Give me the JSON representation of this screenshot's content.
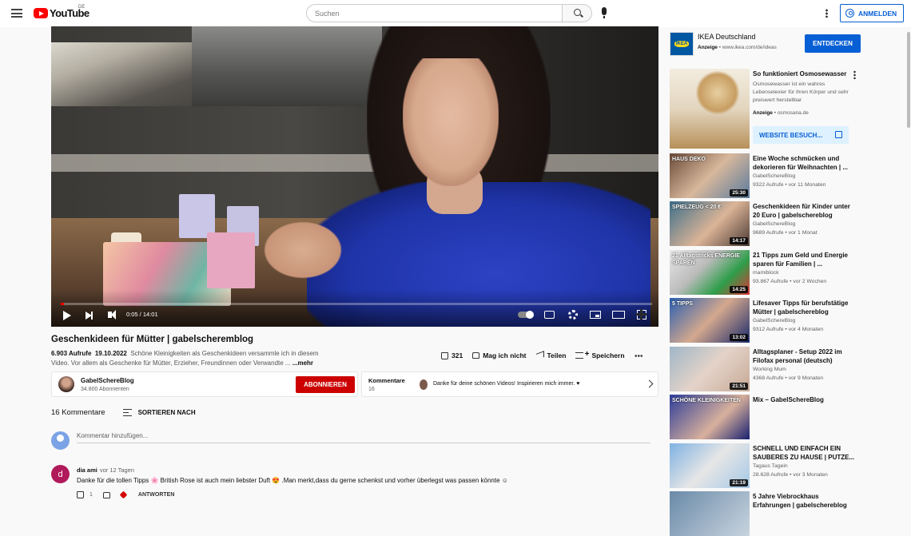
{
  "header": {
    "logo_text": "YouTube",
    "logo_country": "DE",
    "search_placeholder": "Suchen",
    "signin_label": "ANMELDEN"
  },
  "player": {
    "time": "0:05 / 14:01",
    "progress_fraction": 0.006
  },
  "video": {
    "title": "Geschenkideen für Mütter | gabelscheremblog",
    "views": "6.903 Aufrufe",
    "date": "19.10.2022",
    "description_line1": "Schöne Kleinigkeiten als Geschenkideen versammle ich in diesem",
    "description_line2": "Video. Vor allem als Geschenke für Mütter, Erzieher, Freundinnen oder Verwandte ...",
    "more_label": "...mehr",
    "likes": "321",
    "dislike_label": "Mag ich nicht",
    "share_label": "Teilen",
    "save_label": "Speichern"
  },
  "channel": {
    "name": "GabelSchereBlog",
    "subscribers": "34.800 Abonnenten",
    "subscribe_label": "ABONNIEREN"
  },
  "comments_teaser": {
    "label": "Kommentare",
    "count": "16",
    "text": "Danke für deine schönen Videos! Inspirieren mich immer. ♥"
  },
  "comments": {
    "count_label": "16 Kommentare",
    "sort_label": "SORTIEREN NACH",
    "add_placeholder": "Kommentar hinzufügen...",
    "items": [
      {
        "avatar_letter": "d",
        "author": "dia ami",
        "time": "vor 12 Tagen",
        "text": "Danke für die tollen Tipps 🌸 British Rose ist auch mein liebster Duft 😍 .Man merkt,dass du gerne schenkst und vorher überlegst was passen könnte ☺",
        "likes": "1",
        "reply_label": "ANTWORTEN"
      }
    ]
  },
  "ad": {
    "advertiser": "IKEA Deutschland",
    "logo_text": "IKEA",
    "ad_label": "Anzeige",
    "url": "www.ikea.com/de/ideas",
    "cta": "ENTDECKEN"
  },
  "promo": {
    "title": "So funktioniert Osmosewasser",
    "description": "Osmosewasser ist ein wahres Lebenselexier für ihren Körper und sehr preiswert herstellbar",
    "ad_label": "Anzeige",
    "domain": "osmosana.de",
    "cta": "WEBSITE BESUCH..."
  },
  "recommendations": [
    {
      "title": "Eine Woche schmücken und dekorieren für Weihnachten | ...",
      "channel": "GabelSchereBlog",
      "views": "9322 Aufrufe • vor 11 Monaten",
      "duration": "25:30",
      "thumb_text": "HAUS DEKO"
    },
    {
      "title": "Geschenkideen für Kinder unter 20 Euro | gabelschereblog",
      "channel": "GabelSchereBlog",
      "views": "9689 Aufrufe • vor 1 Monat",
      "duration": "14:17",
      "thumb_text": "SPIELZEUG < 20 €"
    },
    {
      "title": "21 Tipps zum Geld und Energie sparen für Familien | ...",
      "channel": "mamiblock",
      "views": "93.867 Aufrufe • vor 2 Wochen",
      "duration": "14:25",
      "thumb_text": "21 Alltagstricks ENERGIE SPAREN"
    },
    {
      "title": "Lifesaver Tipps für berufstätige Mütter | gabelschereblog",
      "channel": "GabelSchereBlog",
      "views": "9312 Aufrufe • vor 4 Monaten",
      "duration": "13:02",
      "thumb_text": "5 TIPPS"
    },
    {
      "title": "Alltagsplaner - Setup 2022 im Filofax personal (deutsch)",
      "channel": "Working Mum",
      "views": "4368 Aufrufe • vor 9 Monaten",
      "duration": "21:51",
      "thumb_text": ""
    },
    {
      "title": "Mix – GabelSchereBlog",
      "channel": "",
      "views": "",
      "duration": "",
      "thumb_text": "SCHÖNE KLEINIGKEITEN"
    },
    {
      "title": "SCHNELL UND EINFACH EIN SAUBERES ZU HAUSE | PUTZE...",
      "channel": "Tagaus Tagein",
      "views": "28.628 Aufrufe • vor 3 Monaten",
      "duration": "21:19",
      "thumb_text": ""
    },
    {
      "title": "5 Jahre Viebrockhaus Erfahrungen | gabelschereblog",
      "channel": "",
      "views": "",
      "duration": "",
      "thumb_text": ""
    }
  ],
  "colors": {
    "brand_red": "#ff0000",
    "subscribe_red": "#cc0000",
    "link_blue": "#065fd4",
    "progress_red": "#ff0000"
  }
}
